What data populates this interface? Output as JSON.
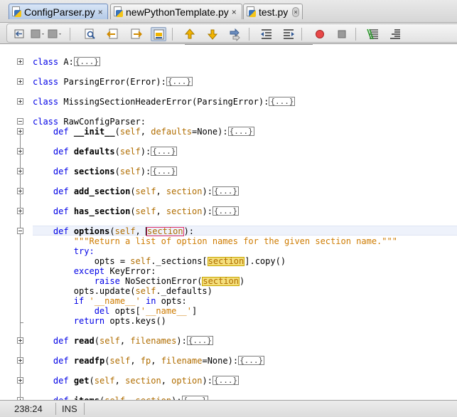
{
  "tabs": [
    {
      "label": "ConfigParser.py",
      "close": "×",
      "active": true
    },
    {
      "label": "newPythonTemplate.py",
      "close": "×",
      "active": false
    },
    {
      "label": "test.py",
      "close": "×",
      "active": false
    }
  ],
  "toolbar": {
    "buttons": [
      "back-icon",
      "forward-icon",
      "last-edit-icon",
      "find-icon",
      "find-previous-icon",
      "find-next-icon",
      "toggle-highlight-icon",
      "previous-bookmark-icon",
      "next-bookmark-icon",
      "toggle-bookmark-icon",
      "shift-left-icon",
      "shift-right-icon",
      "start-macro-icon",
      "stop-macro-icon",
      "comment-icon",
      "uncomment-icon"
    ]
  },
  "code": {
    "fold_marker": "{...}",
    "class_a": "class",
    "class_a_name": " A:",
    "class_parsing": "class",
    "class_parsing_name": " ParsingError(Error):",
    "class_missing": "class",
    "class_missing_name": " MissingSectionHeaderError(ParsingError):",
    "class_raw": "class",
    "class_raw_name": " RawConfigParser:",
    "def_kw": "def",
    "init_name": "__init__",
    "init_open": "(",
    "init_self": "self",
    "init_mid": ", ",
    "init_param": "defaults",
    "init_rest": "=None):",
    "defaults_name": "defaults",
    "sections_name": "sections",
    "add_section_name": "add_section",
    "has_section_name": "has_section",
    "options_name": "options",
    "self_word": "self",
    "section_word": "section",
    "open_paren": "(",
    "close_colon": "):",
    "comma_space": ", ",
    "docstring": "\"\"\"Return a list of option names for the given section name.\"\"\"",
    "try_kw": "try:",
    "opts_assign_a": "opts = ",
    "opts_assign_b": "._sections[",
    "opts_assign_c": "].copy()",
    "except_kw": "except",
    "except_rest": " KeyError:",
    "raise_kw": "raise",
    "raise_rest": " NoSectionError(",
    "raise_close": ")",
    "update_a": "opts.update(",
    "update_b": "._defaults)",
    "if_kw": "if",
    "name_str": "'__name__'",
    "in_kw": "in",
    "if_rest": " opts:",
    "del_kw": "del",
    "del_a": " opts[",
    "del_close": "]",
    "return_kw": "return",
    "return_rest": " opts.keys()",
    "read_name": "read",
    "filenames_param": "filenames",
    "readfp_name": "readfp",
    "fp_param": "fp",
    "filename_param": "filename",
    "readfp_rest": "=None):",
    "get_name": "get",
    "option_param": "option",
    "items_name": "items"
  },
  "status": {
    "position": "238:24",
    "mode": "INS"
  }
}
